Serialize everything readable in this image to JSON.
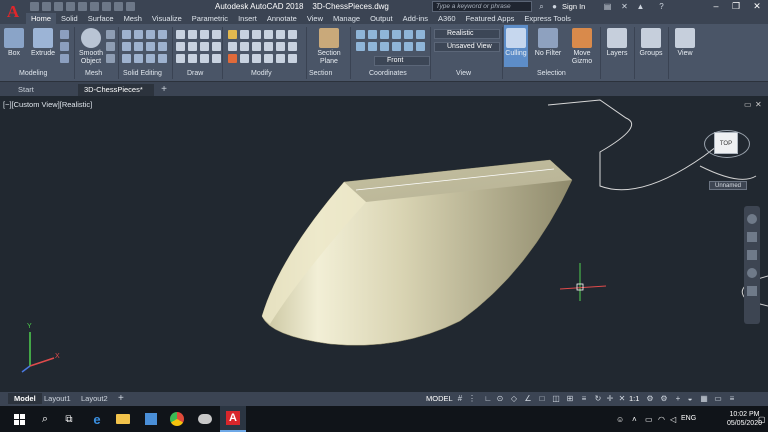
{
  "title_bar": {
    "app_title": "Autodesk AutoCAD 2018",
    "file_name": "3D-ChessPieces.dwg",
    "search_placeholder": "Type a keyword or phrase",
    "sign_in": "Sign In"
  },
  "ribbon_tabs": [
    "Home",
    "Solid",
    "Surface",
    "Mesh",
    "Visualize",
    "Parametric",
    "Insert",
    "Annotate",
    "View",
    "Manage",
    "Output",
    "Add-ins",
    "A360",
    "Featured Apps",
    "Express Tools"
  ],
  "ribbon": {
    "box": "Box",
    "extrude": "Extrude",
    "smooth_object_1": "Smooth",
    "smooth_object_2": "Object",
    "section_plane_1": "Section",
    "section_plane_2": "Plane",
    "visual_style": "Realistic",
    "saved_view": "Unsaved View",
    "view_direction": "Front",
    "culling": "Culling",
    "no_filter": "No Filter",
    "move_gizmo_1": "Move",
    "move_gizmo_2": "Gizmo",
    "layers": "Layers",
    "groups": "Groups",
    "view": "View",
    "panels": {
      "modeling": "Modeling",
      "mesh": "Mesh",
      "solid_editing": "Solid Editing",
      "draw": "Draw",
      "modify": "Modify",
      "section": "Section",
      "coordinates": "Coordinates",
      "view": "View",
      "selection": "Selection"
    }
  },
  "file_tabs": [
    "Start",
    "3D-ChessPieces*"
  ],
  "viewport": {
    "label": "[−][Custom View][Realistic]",
    "viewcube_face": "TOP",
    "ucs_label": "Unnamed"
  },
  "layout_tabs": [
    "Model",
    "Layout1",
    "Layout2"
  ],
  "status_bar": {
    "model": "MODEL",
    "scale": "1:1"
  },
  "taskbar": {
    "language": "ENG",
    "time": "10:02 PM",
    "date": "05/05/2020"
  },
  "colors": {
    "app_red": "#e0262a",
    "ribbon_bg": "#4a5567",
    "viewport_bg": "#212830",
    "solid_fill": "#d8d4b4",
    "culling_active": "#5d8dc8"
  }
}
